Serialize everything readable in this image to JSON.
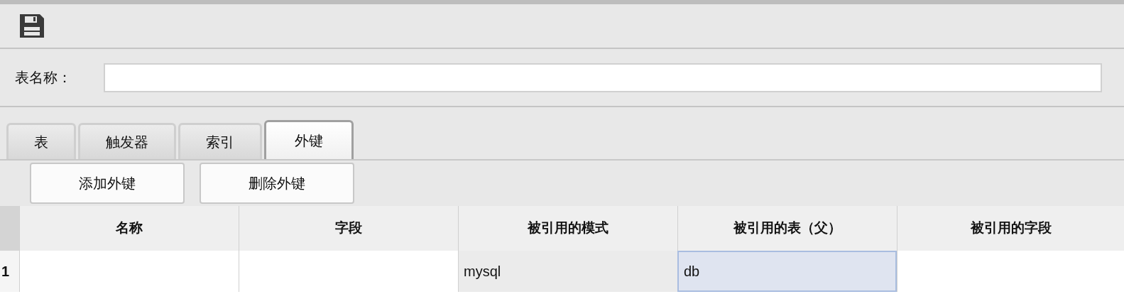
{
  "form": {
    "label": "表名称："
  },
  "tabs": [
    {
      "label": "表",
      "selected": false
    },
    {
      "label": "触发器",
      "selected": false
    },
    {
      "label": "索引",
      "selected": false
    },
    {
      "label": "外键",
      "selected": true
    }
  ],
  "buttons": [
    "添加外键",
    "删除外键"
  ],
  "table": {
    "columns": [
      "名称",
      "字段",
      "被引用的模式",
      "被引用的表（父）",
      "被引用的字段"
    ],
    "rows": [
      {
        "number": "1",
        "cells": [
          {
            "text": "",
            "selected": false,
            "readonly": false
          },
          {
            "text": "",
            "selected": false,
            "readonly": false
          },
          {
            "text": "mysql",
            "selected": false,
            "readonly": true
          },
          {
            "text": "db",
            "selected": true,
            "readonly": false
          },
          {
            "text": "",
            "selected": false,
            "readonly": false
          }
        ]
      }
    ]
  }
}
